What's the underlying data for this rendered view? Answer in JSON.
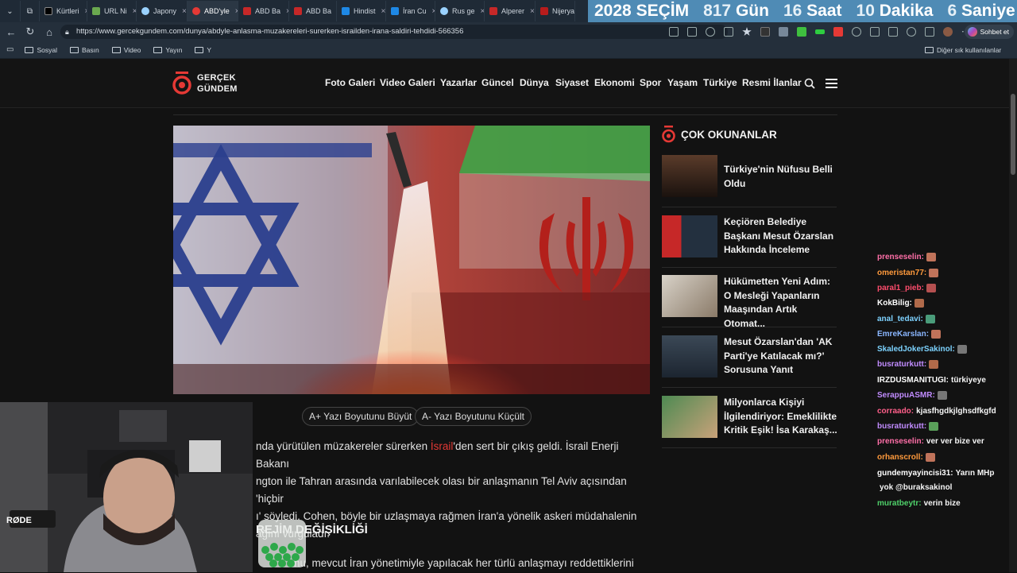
{
  "tabs": [
    {
      "label": "Kürtleri"
    },
    {
      "label": "URL Ni"
    },
    {
      "label": "Japony"
    },
    {
      "label": "ABD'yle"
    },
    {
      "label": "ABD Ba"
    },
    {
      "label": "ABD Ba"
    },
    {
      "label": "Hindist"
    },
    {
      "label": "İran Cu"
    },
    {
      "label": "Rus ge"
    },
    {
      "label": "Alperer"
    },
    {
      "label": "Nijerya"
    }
  ],
  "banner": {
    "year": "2028",
    "word": "SEÇİM",
    "days_num": "817",
    "days_label": "Gün",
    "hours_num": "16",
    "hours_label": "Saat",
    "minutes_num": "10",
    "minutes_label": "Dakika",
    "seconds_num": "6",
    "seconds_label": "Saniye"
  },
  "browser": {
    "url": "https://www.gercekgundem.com/dunya/abdyle-anlasma-muzakereleri-surerken-israilden-irana-saldiri-tehdidi-566356",
    "chat_button": "Sohbet et",
    "bookmarks": [
      "Sosyal",
      "Basın",
      "Video",
      "Yayın",
      "Y"
    ],
    "other_bookmarks": "Diğer sık kullanılanlar"
  },
  "site": {
    "logo_line1": "GERÇEK",
    "logo_line2": "GÜNDEM",
    "nav": [
      "Foto Galeri",
      "Video Galeri",
      "Yazarlar",
      "Güncel",
      "Dünya",
      "Siyaset",
      "Ekonomi",
      "Spor",
      "Yaşam",
      "Türkiye",
      "Resmi İlanlar"
    ]
  },
  "article": {
    "font_increase": "Yazı Boyutunu Büyüt",
    "font_decrease": "Yazı Boyutunu Küçült",
    "font_increase_icon": "A+",
    "font_decrease_icon": "A-",
    "p1_a": "nda yürütülen müzakereler sürerken ",
    "p1_link": "İsrail",
    "p1_b": "'den sert bir çıkış geldi. İsrail Enerji Bakanı",
    "p1_l2": "ngton ile Tahran arasında varılabilecek olası bir anlaşmanın Tel Aviv açısından 'hiçbir",
    "p1_l3": "ı' söyledi. Cohen, böyle bir uzlaşmaya rağmen İran'a yönelik askeri müdahalenin",
    "p1_l4": "ağını vurguladı.",
    "subheading": "REJİM DEĞİŞİKLİĞİ",
    "p2": "nu, mevcut İran yönetimiyle yapılacak her türlü anlaşmayı reddettiklerini"
  },
  "sidebar": {
    "title": "ÇOK OKUNANLAR",
    "items": [
      {
        "title": "Türkiye'nin Nüfusu Belli Oldu"
      },
      {
        "title": "Keçiören Belediye Başkanı Mesut Özarslan Hakkında İnceleme"
      },
      {
        "title": "Hükümetten Yeni Adım: O Mesleği Yapanların Maaşından Artık Otomat..."
      },
      {
        "title": "Mesut Özarslan'dan 'AK Parti'ye Katılacak mı?' Sorusuna Yanıt"
      },
      {
        "title": "Milyonlarca Kişiyi İlgilendiriyor: Emeklilikte Kritik Eşik! İsa Karakaş..."
      }
    ]
  },
  "chat": [
    {
      "user": "prenseselin:",
      "msg": "",
      "color": "#ff6fa8"
    },
    {
      "user": "omeristan77:",
      "msg": "",
      "color": "#ff9a3c"
    },
    {
      "user": "paral1_pieb:",
      "msg": "",
      "color": "#ff4d6d"
    },
    {
      "user": "KokBilig:",
      "msg": "",
      "color": "#ffffff"
    },
    {
      "user": "anal_tedavi:",
      "msg": "",
      "color": "#7ed2ff"
    },
    {
      "user": "EmreKarslan:",
      "msg": "",
      "color": "#8ab6ff"
    },
    {
      "user": "SkaledJokerSakinol:",
      "msg": "",
      "color": "#7dd3ff"
    },
    {
      "user": "busraturkutt:",
      "msg": "",
      "color": "#c18cff"
    },
    {
      "user": "IRZDUSMANITUGI:",
      "msg": "türkiyeye",
      "color": "#ffffff"
    },
    {
      "user": "SerappuASMR:",
      "msg": "",
      "color": "#c18cff"
    },
    {
      "user": "corraado:",
      "msg": "kjasfhgdkjlghsdfkgfd",
      "color": "#ff5f8a"
    },
    {
      "user": "busraturkutt:",
      "msg": "",
      "color": "#c18cff"
    },
    {
      "user": "prenseselin:",
      "msg": "ver ver bize ver",
      "color": "#ff6fa8"
    },
    {
      "user": "orhanscroll:",
      "msg": "",
      "color": "#ff9a3c"
    },
    {
      "user": "gundemyayincisi31:",
      "msg": "Yarın MHp",
      "color": "#ffffff"
    },
    {
      "user": "",
      "msg": "yok @buraksakinol",
      "color": "#ffffff"
    },
    {
      "user": "muratbeytr:",
      "msg": "verin bize",
      "color": "#4fd16a"
    }
  ],
  "cam": {
    "mic_brand": "RØDE"
  }
}
